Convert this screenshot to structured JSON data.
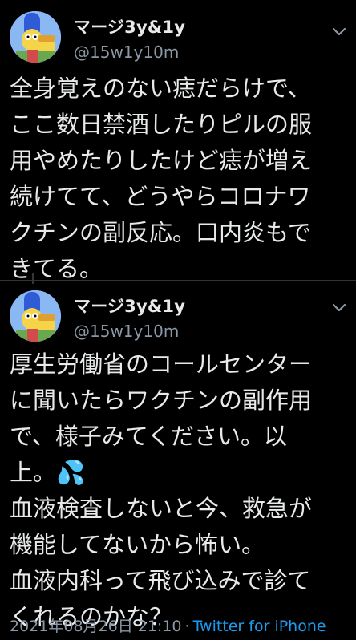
{
  "tweets": [
    {
      "display_name": "マージ3y&1y",
      "handle": "@15w1y10m",
      "lines": [
        "全身覚えのない痣だらけで、",
        "ここ数日禁酒したりピルの服",
        "用やめたりしたけど痣が増え",
        "続けてて、どうやらコロナワ",
        "クチンの副反応。口内炎もで",
        "きてる。"
      ],
      "avatar_icon": "cartoon-avatar-icon",
      "menu_icon": "chevron-down-icon"
    },
    {
      "display_name": "マージ3y&1y",
      "handle": "@15w1y10m",
      "lines": [
        "厚生労働省のコールセンター",
        "に聞いたらワクチンの副作用",
        "で、様子みてください。以",
        "上。💦",
        "血液検査しないと今、救急が",
        "機能してないから怖い。",
        "血液内科って飛び込みで診て",
        "くれるのかな？"
      ],
      "timestamp": "2021年08月26日 21:10",
      "separator": "·",
      "source": "Twitter for iPhone",
      "avatar_icon": "cartoon-avatar-icon",
      "menu_icon": "chevron-down-icon"
    }
  ],
  "colors": {
    "background": "#000000",
    "text": "#e7e9ea",
    "secondary_text": "#8b98a5",
    "link": "#1d9bf0"
  }
}
